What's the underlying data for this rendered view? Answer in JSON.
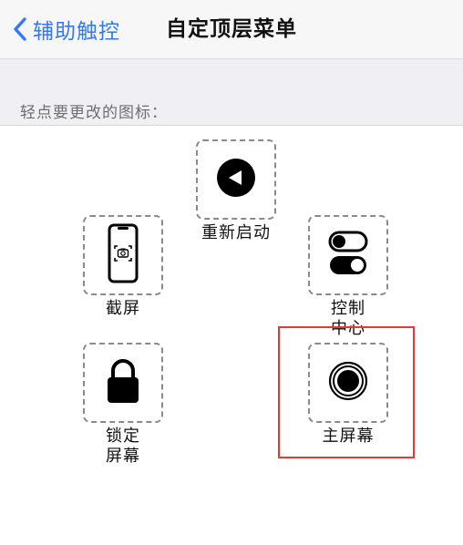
{
  "navbar": {
    "back_label": "辅助触控",
    "title": "自定顶层菜单"
  },
  "section": {
    "header": "轻点要更改的图标："
  },
  "icons": [
    {
      "id": "restart",
      "label": "重新启动",
      "icon": "restart-icon"
    },
    {
      "id": "screenshot",
      "label": "截屏",
      "icon": "screenshot-icon"
    },
    {
      "id": "control-center",
      "label": "控制\n中心",
      "icon": "control-center-icon"
    },
    {
      "id": "lock-screen",
      "label": "锁定\n屏幕",
      "icon": "lock-icon"
    },
    {
      "id": "home",
      "label": "主屏幕",
      "icon": "home-button-icon"
    }
  ],
  "colors": {
    "accent": "#3478f6",
    "highlight": "#e53935"
  }
}
